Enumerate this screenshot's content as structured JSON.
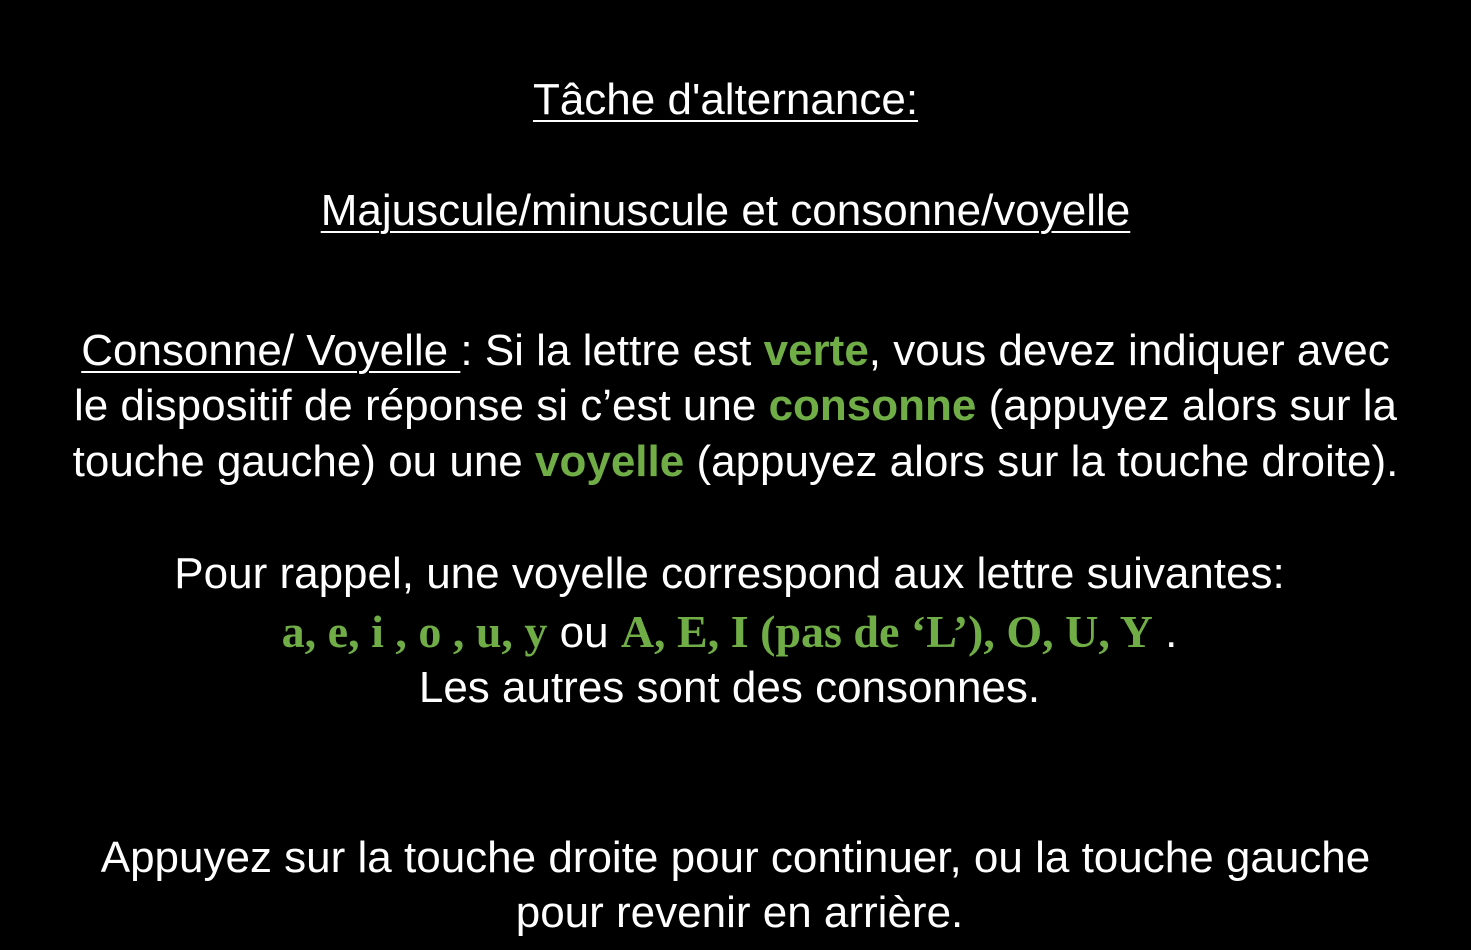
{
  "colors": {
    "background": "#000000",
    "text": "#ffffff",
    "highlight_green": "#70ad47"
  },
  "title": "Tâche d'alternance:",
  "subtitle": "Majuscule/minuscule et consonne/voyelle",
  "instruction": {
    "label": "Consonne/ Voyelle ",
    "line1_a": ": Si la lettre est ",
    "line1_green": "verte",
    "line1_b": ", vous devez indiquer avec",
    "line2_a": "le dispositif de réponse si c’est une ",
    "line2_green": "consonne",
    "line2_b": " (appuyez alors sur la",
    "line3_a": "touche gauche) ou une ",
    "line3_green": "voyelle",
    "line3_b": " (appuyez alors sur la touche droite)."
  },
  "reminder": {
    "line1": "Pour rappel, une voyelle correspond aux lettre suivantes:",
    "lowercase_vowels": "a, e, i , o , u,  y",
    "or_word": " ou  ",
    "uppercase_vowels": "A, E, I (pas de ‘L’), O, U, Y",
    "end_punct": " .",
    "line3": "Les autres sont des consonnes."
  },
  "navigation": {
    "line1": "Appuyez sur la touche droite pour continuer, ou la touche gauche",
    "line2": "pour revenir en arrière."
  }
}
